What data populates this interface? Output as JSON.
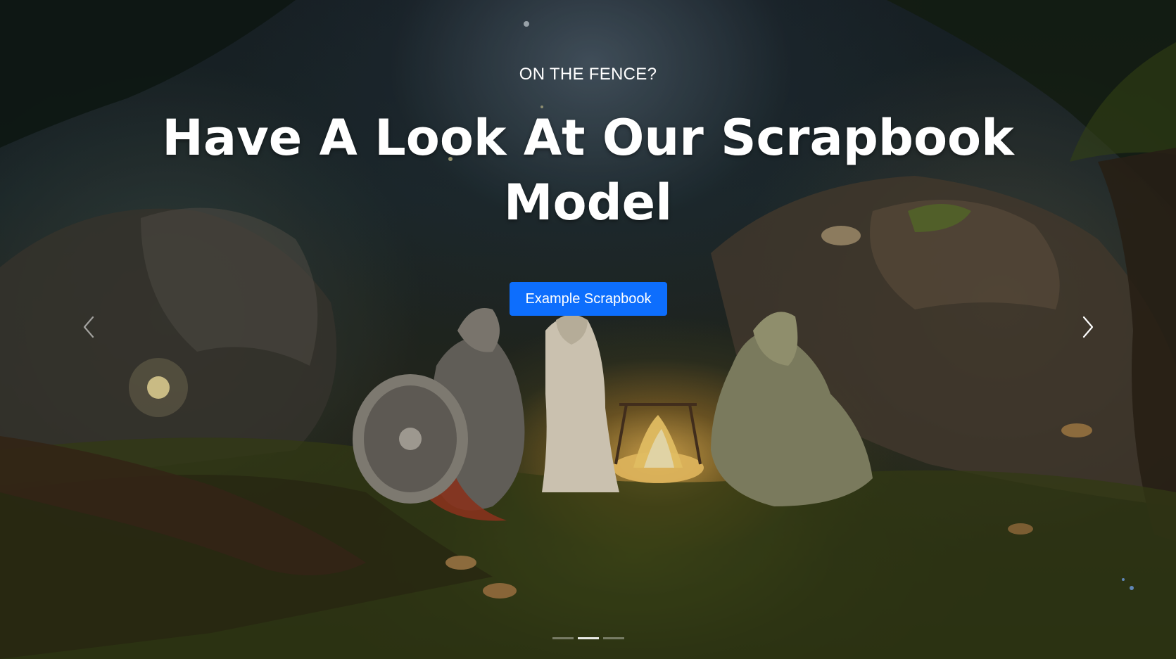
{
  "hero": {
    "eyebrow": "ON THE FENCE?",
    "headline": "Have A Look At Our Scrapbook Model",
    "cta_label": "Example Scrapbook",
    "accent_color": "#0d6efd"
  },
  "carousel": {
    "prev_icon": "chevron-left-icon",
    "next_icon": "chevron-right-icon",
    "slide_count": 3,
    "active_slide": 2
  }
}
